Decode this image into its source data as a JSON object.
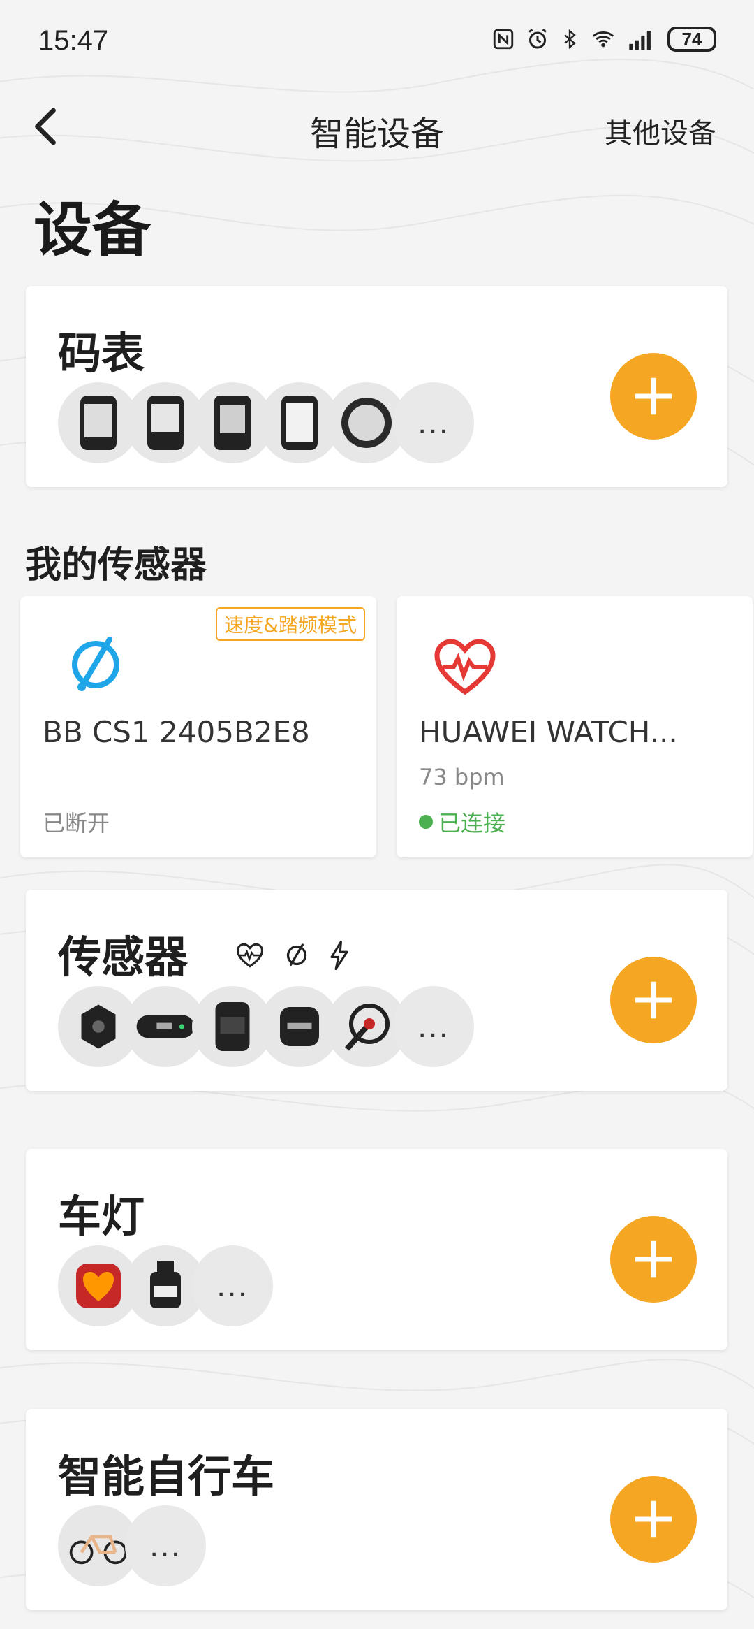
{
  "status_bar": {
    "time": "15:47",
    "battery": "74",
    "icons": [
      "nfc-icon",
      "alarm-icon",
      "bluetooth-icon",
      "wifi-icon",
      "signal-icon"
    ]
  },
  "header": {
    "title": "智能设备",
    "right_action": "其他设备"
  },
  "page": {
    "title": "设备"
  },
  "sections": {
    "bike_computer": {
      "title": "码表",
      "thumb_icons": [
        "bike-computer-1-icon",
        "bike-computer-2-icon",
        "bike-computer-3-icon",
        "bike-computer-4-icon",
        "bike-computer-5-icon"
      ],
      "more": "..."
    },
    "my_sensors": {
      "label": "我的传感器",
      "items": [
        {
          "badge": "速度&踏频模式",
          "name": "BB CS1 2405B2E8",
          "status": "已断开",
          "icon": "cadence-sensor-icon"
        },
        {
          "name": "HUAWEI WATCH...",
          "bpm_value": "73",
          "bpm_unit": "bpm",
          "status": "已连接",
          "icon": "heart-rate-icon"
        }
      ]
    },
    "sensors": {
      "title": "传感器",
      "type_icons": [
        "heart-rate-icon",
        "cadence-icon",
        "power-icon"
      ],
      "thumb_icons": [
        "speed-sensor-icon",
        "hr-strap-icon",
        "armband-icon",
        "cadence-sensor-icon",
        "power-meter-icon"
      ],
      "more": "..."
    },
    "lights": {
      "title": "车灯",
      "thumb_icons": [
        "rear-light-icon",
        "front-light-icon"
      ],
      "more": "..."
    },
    "smart_bike": {
      "title": "智能自行车",
      "thumb_icons": [
        "bicycle-icon"
      ],
      "more": "..."
    }
  },
  "colors": {
    "accent": "#f5a623",
    "connected": "#4caf50",
    "sensor_blue": "#1fa6e8",
    "heart_red": "#e53935"
  }
}
